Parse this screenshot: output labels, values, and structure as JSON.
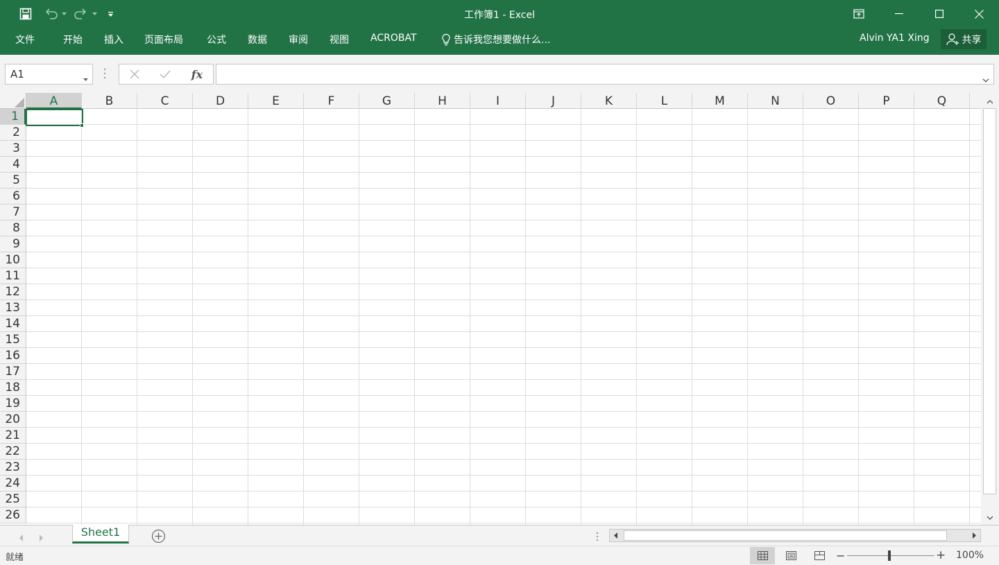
{
  "window": {
    "title": "工作簿1 - Excel"
  },
  "ribbon": {
    "tabs": [
      {
        "label": "文件"
      },
      {
        "label": "开始"
      },
      {
        "label": "插入"
      },
      {
        "label": "页面布局"
      },
      {
        "label": "公式"
      },
      {
        "label": "数据"
      },
      {
        "label": "审阅"
      },
      {
        "label": "视图"
      },
      {
        "label": "ACROBAT"
      }
    ],
    "tell_me": "告诉我您想要做什么...",
    "user_name": "Alvin YA1 Xing",
    "share_label": "共享"
  },
  "formula_bar": {
    "name_box": "A1",
    "formula_value": ""
  },
  "grid": {
    "columns": [
      "A",
      "B",
      "C",
      "D",
      "E",
      "F",
      "G",
      "H",
      "I",
      "J",
      "K",
      "L",
      "M",
      "N",
      "O",
      "P",
      "Q"
    ],
    "rows": [
      "1",
      "2",
      "3",
      "4",
      "5",
      "6",
      "7",
      "8",
      "9",
      "10",
      "11",
      "12",
      "13",
      "14",
      "15",
      "16",
      "17",
      "18",
      "19",
      "20",
      "21",
      "22",
      "23",
      "24",
      "25",
      "26"
    ],
    "active_column": "A",
    "active_row": "1"
  },
  "sheets": {
    "tabs": [
      {
        "label": "Sheet1"
      }
    ]
  },
  "status": {
    "text": "就绪",
    "zoom": "100%"
  },
  "colors": {
    "accent": "#217346",
    "share_button": "#1b5e38"
  },
  "icons": {
    "save": "save-icon",
    "undo": "undo-icon",
    "redo": "redo-icon",
    "customize": "customize-qat-icon",
    "ribbon_display": "ribbon-display-options-icon",
    "minimize": "minimize-icon",
    "maximize": "maximize-icon",
    "close": "close-icon",
    "lightbulb": "lightbulb-icon",
    "share": "person-add-icon",
    "cancel": "cancel-x-icon",
    "enter": "checkmark-icon",
    "function": "fx-icon",
    "add_sheet": "add-sheet-icon",
    "normal_view": "normal-view-icon",
    "page_layout_view": "page-layout-view-icon",
    "page_break_view": "page-break-preview-icon"
  }
}
